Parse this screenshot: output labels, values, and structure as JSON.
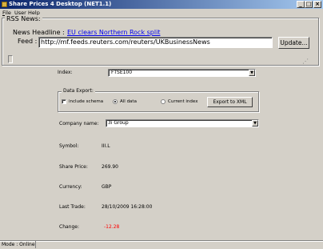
{
  "window": {
    "title": "Share Prices 4 Desktop (NET1.1)"
  },
  "menu": [
    {
      "label": "File",
      "accel": "F",
      "rest": "ile"
    },
    {
      "label": "User",
      "accel": "U",
      "rest": "ser"
    },
    {
      "label": "Help",
      "accel": "H",
      "rest": "elp"
    }
  ],
  "rss": {
    "group_label": "RSS News:",
    "headline_label": "News Headline :",
    "headline_text": "EU clears Northern Rock split",
    "feed_label": "Feed :",
    "feed_url": "http://mf.feeds.reuters.com/reuters/UKBusinessNews",
    "update_button": "Update..."
  },
  "index": {
    "label": "Index:",
    "value": "FTSE100"
  },
  "export": {
    "group_label": "Data Export:",
    "include_schema": "include schema",
    "all_data": "All data",
    "current_index": "Current index",
    "export_button": "Export to XML",
    "include_schema_checked": false,
    "selected": "all_data"
  },
  "company": {
    "label": "Company name:",
    "value": "3i Group"
  },
  "details": {
    "symbol_label": "Symbol:",
    "symbol": "III.L",
    "price_label": "Share Price:",
    "price": "269.90",
    "currency_label": "Currency:",
    "currency": "GBP",
    "lasttrade_label": "Last Trade:",
    "lasttrade": "28/10/2009 16:28:00",
    "change_label": "Change:",
    "change": "-12.28"
  },
  "status": {
    "mode": "Mode : Online"
  },
  "colors": {
    "title_start": "#0a246a",
    "title_end": "#a6caf0",
    "link": "#0000ee",
    "change": "#ff0000",
    "face": "#d4d0c8"
  }
}
